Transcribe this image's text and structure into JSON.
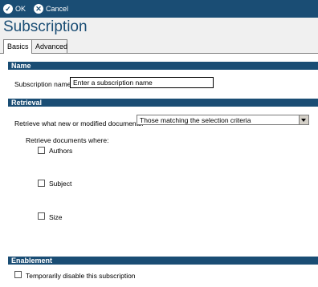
{
  "toolbar": {
    "ok_label": "OK",
    "cancel_label": "Cancel"
  },
  "page": {
    "title": "Subscription"
  },
  "tabs": [
    {
      "label": "Basics",
      "active": true
    },
    {
      "label": "Advanced",
      "active": false
    }
  ],
  "sections": {
    "name": {
      "header": "Name",
      "field_label": "Subscription name:",
      "field_value": "Enter a subscription name"
    },
    "retrieval": {
      "header": "Retrieval",
      "retrieve_label": "Retrieve what new or modified documents:",
      "retrieve_value": "Those matching the selection criteria",
      "criteria_label": "Retrieve documents where:",
      "criteria": [
        {
          "label": "Authors",
          "checked": false
        },
        {
          "label": "Subject",
          "checked": false
        },
        {
          "label": "Size",
          "checked": false
        }
      ]
    },
    "enablement": {
      "header": "Enablement",
      "disable_label": "Temporarily disable this subscription",
      "disable_checked": false
    }
  },
  "colors": {
    "accent": "#1a4d74"
  }
}
